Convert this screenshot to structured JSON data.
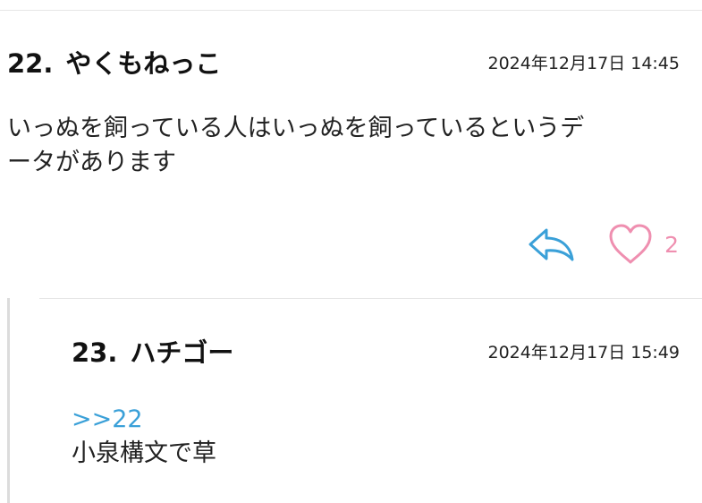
{
  "comments": [
    {
      "number": "22.",
      "author": "やくもねっこ",
      "date": "2024年12月17日 14:45",
      "body_line1": "いっぬを飼っている人はいっぬを飼っているというデ",
      "body_line2": "ータがあります",
      "likes": "2",
      "icons": {
        "reply": "reply-arrow-icon",
        "like": "heart-outline-icon"
      }
    }
  ],
  "reply": {
    "number": "23.",
    "author": "ハチゴー",
    "date": "2024年12月17日 15:49",
    "anchor": ">>22",
    "body": "小泉構文で草"
  },
  "colors": {
    "reply_icon": "#3aa0d8",
    "heart_icon": "#ef8fb0",
    "anchor_link": "#3aa0d8"
  }
}
